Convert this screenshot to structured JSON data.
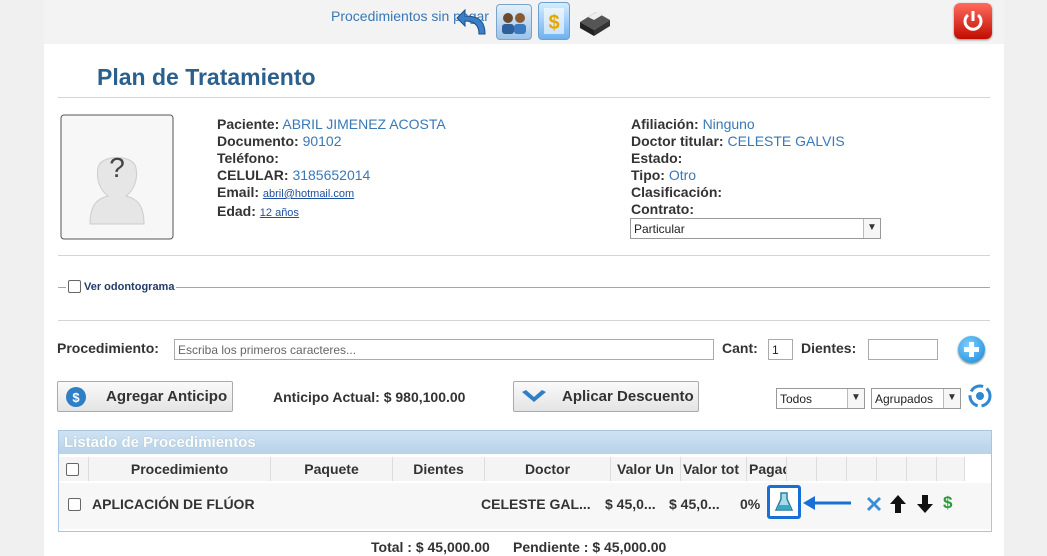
{
  "topbar": {
    "link_text": "Procedimientos sin pagar",
    "icons": [
      "back-arrow-icon",
      "patients-icon",
      "billing-icon",
      "printer-icon",
      "power-icon"
    ]
  },
  "page_title": "Plan de Tratamiento",
  "patient": {
    "left": [
      {
        "label": "Paciente:",
        "value": "ABRIL JIMENEZ ACOSTA"
      },
      {
        "label": "Documento:",
        "value": "90102"
      },
      {
        "label": "Teléfono:",
        "value": ""
      },
      {
        "label": "CELULAR:",
        "value": "3185652014"
      },
      {
        "label": "Email:",
        "value": "abril@hotmail.com"
      },
      {
        "label": "Edad:",
        "value": "12 años"
      }
    ],
    "right": [
      {
        "label": "Afiliación:",
        "value": "Ninguno"
      },
      {
        "label": "Doctor titular:",
        "value": "CELESTE GALVIS"
      },
      {
        "label": "Estado:",
        "value": ""
      },
      {
        "label": "Tipo:",
        "value": "Otro"
      },
      {
        "label": "Clasificación:",
        "value": ""
      },
      {
        "label": "Contrato:",
        "value": ""
      }
    ],
    "contrato_selected": "Particular"
  },
  "odontograma_label": "Ver odontograma",
  "procedure_form": {
    "procedimiento_label": "Procedimiento:",
    "procedimiento_placeholder": "Escriba los primeros caracteres...",
    "cant_label": "Cant:",
    "cant_value": "1",
    "dientes_label": "Dientes:"
  },
  "actions": {
    "agregar_anticipo": "Agregar Anticipo",
    "anticipo_actual": "Anticipo Actual: $ 980,100.00",
    "aplicar_descuento": "Aplicar Descuento",
    "filter_selected": "Todos",
    "group_selected": "Agrupados"
  },
  "grid": {
    "title": "Listado de Procedimientos",
    "columns": [
      "Procedimiento",
      "Paquete",
      "Dientes",
      "Doctor",
      "Valor Un",
      "Valor tot",
      "Pagad"
    ],
    "rows": [
      {
        "procedimiento": "APLICACIÓN DE FLÚOR",
        "paquete": "",
        "dientes": "",
        "doctor": "CELESTE GAL...",
        "valor_unit": "$ 45,0...",
        "valor_total": "$ 45,0...",
        "pagado": "0%"
      }
    ]
  },
  "totals": {
    "total": "Total : $ 45,000.00",
    "pendiente": "Pendiente : $ 45,000.00"
  },
  "colors": {
    "title": "#2b5f8c",
    "link": "#3a78b5",
    "highlight": "#1a6fd6"
  }
}
